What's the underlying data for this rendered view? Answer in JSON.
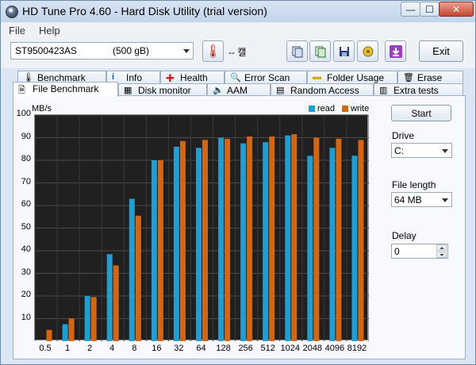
{
  "window": {
    "title": "HD Tune Pro 4.60 - Hard Disk Utility (trial version)",
    "minimize": "—",
    "maximize": "☐",
    "close": "✕"
  },
  "menu": {
    "file": "File",
    "help": "Help"
  },
  "toolbar": {
    "drive_name": "ST9500423AS",
    "drive_size": "(500 gB)",
    "temperature": "-- 캘",
    "exit_label": "Exit",
    "icons": [
      "temperature-icon",
      "copy-info-icon",
      "copy-screen-icon",
      "save-icon",
      "options-icon",
      "download-icon"
    ]
  },
  "tabs": {
    "row1": [
      "Benchmark",
      "Info",
      "Health",
      "Error Scan",
      "Folder Usage",
      "Erase"
    ],
    "row2": [
      "File Benchmark",
      "Disk monitor",
      "AAM",
      "Random Access",
      "Extra tests"
    ]
  },
  "side": {
    "start_label": "Start",
    "drive_label": "Drive",
    "drive_value": "C:",
    "file_length_label": "File length",
    "file_length_value": "64 MB",
    "delay_label": "Delay",
    "delay_value": "0"
  },
  "chart_data": {
    "type": "bar",
    "ylabel": "MB/s",
    "ylim": [
      0,
      100
    ],
    "yticks": [
      10,
      20,
      30,
      40,
      50,
      60,
      70,
      80,
      90,
      100
    ],
    "categories": [
      "0.5",
      "1",
      "2",
      "4",
      "8",
      "16",
      "32",
      "64",
      "128",
      "256",
      "512",
      "1024",
      "2048",
      "4096",
      "8192"
    ],
    "series": [
      {
        "name": "read",
        "color": "#1aa0d6",
        "values": [
          0,
          7.5,
          20,
          38.5,
          63,
          80,
          86,
          85.5,
          90,
          87.5,
          88,
          91,
          82,
          85.5,
          82
        ]
      },
      {
        "name": "write",
        "color": "#d8650e",
        "values": [
          5,
          10,
          19.5,
          33.5,
          55.5,
          80,
          88.5,
          89,
          89.5,
          90.5,
          90.5,
          91.5,
          90,
          89.5,
          89
        ]
      }
    ],
    "grid": true,
    "legend": "top-right"
  }
}
